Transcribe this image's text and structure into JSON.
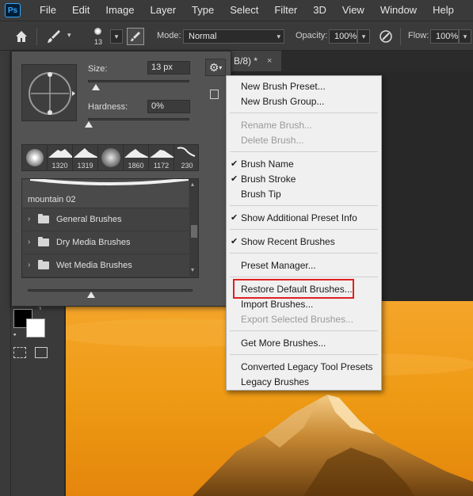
{
  "menubar": {
    "logo": "Ps",
    "items": [
      "File",
      "Edit",
      "Image",
      "Layer",
      "Type",
      "Select",
      "Filter",
      "3D",
      "View",
      "Window",
      "Help"
    ]
  },
  "options_bar": {
    "brush_size": "13",
    "mode_label": "Mode:",
    "mode_value": "Normal",
    "opacity_label": "Opacity:",
    "opacity_value": "100%",
    "flow_label": "Flow:",
    "flow_value": "100%"
  },
  "document_tab": {
    "title": "B/8) *",
    "close": "×"
  },
  "brush_panel": {
    "size_label": "Size:",
    "size_value": "13 px",
    "hardness_label": "Hardness:",
    "hardness_value": "0%",
    "recent_brushes": [
      {
        "num": ""
      },
      {
        "num": "1320"
      },
      {
        "num": "1319"
      },
      {
        "num": ""
      },
      {
        "num": "1860"
      },
      {
        "num": "1172"
      },
      {
        "num": "230"
      }
    ],
    "selected_brush": "mountain 02",
    "folders": [
      "General Brushes",
      "Dry Media Brushes",
      "Wet Media Brushes"
    ]
  },
  "context_menu": {
    "items": [
      {
        "label": "New Brush Preset...",
        "disabled": false,
        "checked": false
      },
      {
        "label": "New Brush Group...",
        "disabled": false,
        "checked": false
      },
      {
        "label": "Rename Brush...",
        "disabled": true,
        "checked": false
      },
      {
        "label": "Delete Brush...",
        "disabled": true,
        "checked": false
      },
      {
        "label": "Brush Name",
        "disabled": false,
        "checked": true
      },
      {
        "label": "Brush Stroke",
        "disabled": false,
        "checked": true
      },
      {
        "label": "Brush Tip",
        "disabled": false,
        "checked": false
      },
      {
        "label": "Show Additional Preset Info",
        "disabled": false,
        "checked": true
      },
      {
        "label": "Show Recent Brushes",
        "disabled": false,
        "checked": true
      },
      {
        "label": "Preset Manager...",
        "disabled": false,
        "checked": false
      },
      {
        "label": "Restore Default Brushes...",
        "disabled": false,
        "checked": false
      },
      {
        "label": "Import Brushes...",
        "disabled": false,
        "checked": false
      },
      {
        "label": "Export Selected Brushes...",
        "disabled": true,
        "checked": false
      },
      {
        "label": "Get More Brushes...",
        "disabled": false,
        "checked": false
      },
      {
        "label": "Converted Legacy Tool Presets",
        "disabled": false,
        "checked": false
      },
      {
        "label": "Legacy Brushes",
        "disabled": false,
        "checked": false
      }
    ],
    "check_glyph": "✔"
  },
  "colors": {
    "menu_bg": "#f0f0f0",
    "highlight": "#e02020",
    "accent": "#31a8ff",
    "sky_orange": "#f2a019"
  }
}
